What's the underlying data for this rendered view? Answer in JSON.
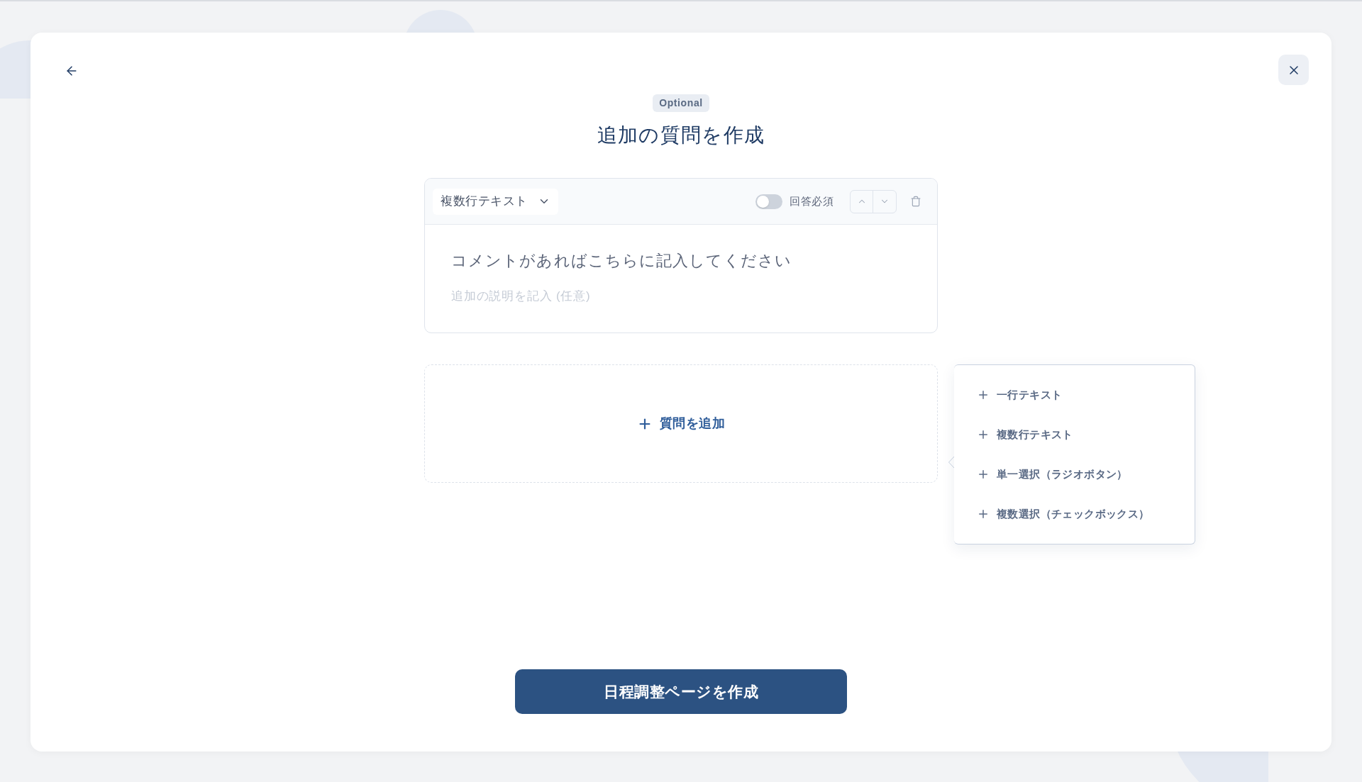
{
  "header": {
    "badge": "Optional",
    "title": "追加の質問を作成"
  },
  "question": {
    "type": "複数行テキスト",
    "required": {
      "label": "回答必須",
      "on": false
    },
    "title": "コメントがあればこちらに記入してください",
    "description": {
      "placeholder": "追加の説明を記入 (任意)"
    }
  },
  "add_question": {
    "label": "質問を追加",
    "menu": {
      "items": [
        {
          "label": "一行テキスト"
        },
        {
          "label": "複数行テキスト"
        },
        {
          "label": "単一選択（ラジオボタン）"
        },
        {
          "label": "複数選択（チェックボックス）"
        }
      ]
    }
  },
  "submit_button": "日程調整ページを作成"
}
